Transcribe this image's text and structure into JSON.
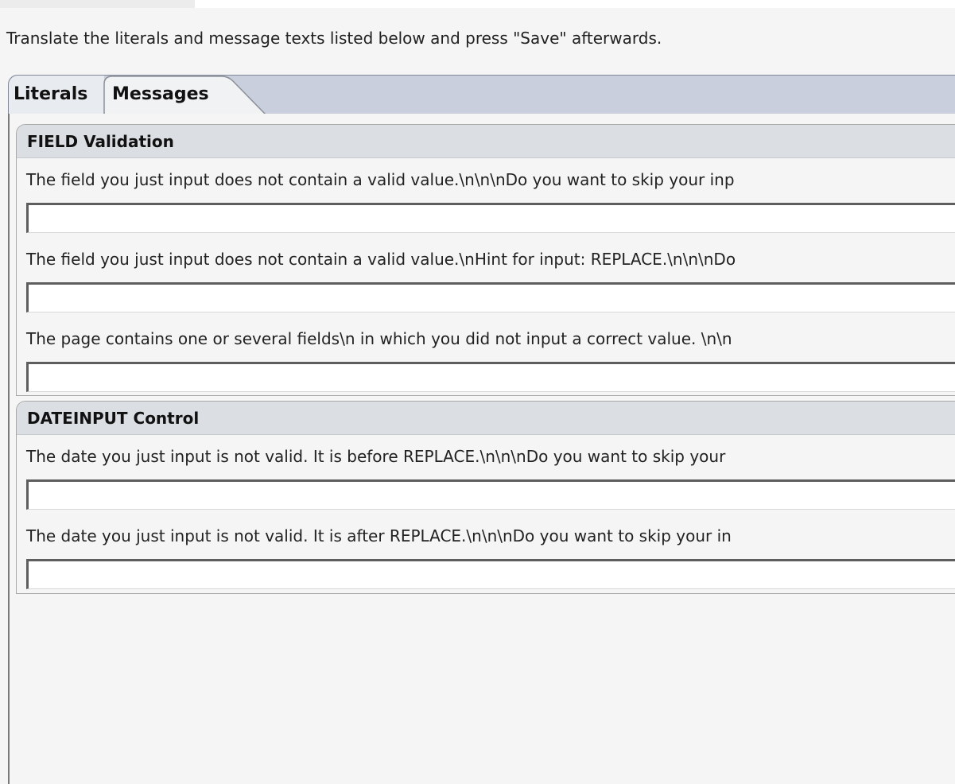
{
  "instruction": "Translate the literals and message texts listed below and press \"Save\" afterwards.",
  "tabs": [
    {
      "label": "Literals",
      "active": false
    },
    {
      "label": "Messages",
      "active": true
    }
  ],
  "groups": [
    {
      "title": "FIELD Validation",
      "messages": [
        {
          "text": "The field you just input does not contain a valid value.\\n\\n\\nDo you want to skip your inp",
          "value": ""
        },
        {
          "text": "The field you just input does not contain a valid value.\\nHint for input: REPLACE.\\n\\n\\nDo",
          "value": ""
        },
        {
          "text": "The page contains one or several fields\\n in which you did not input a correct value. \\n\\n",
          "value": ""
        }
      ]
    },
    {
      "title": "DATEINPUT Control",
      "messages": [
        {
          "text": "The date you just input is not valid. It is before REPLACE.\\n\\n\\nDo you want to skip your",
          "value": ""
        },
        {
          "text": "The date you just input is not valid. It is after REPLACE.\\n\\n\\nDo you want to skip your in",
          "value": ""
        }
      ]
    }
  ]
}
